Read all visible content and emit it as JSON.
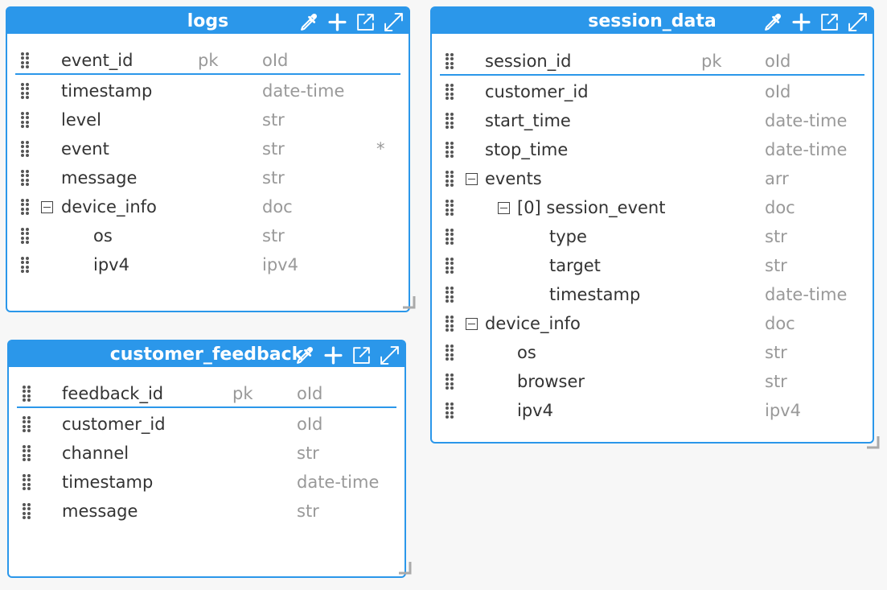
{
  "entities": {
    "logs": {
      "title": "logs",
      "fields": [
        {
          "name": "event_id",
          "key": "pk",
          "type": "oId",
          "req": ""
        },
        {
          "name": "timestamp",
          "key": "",
          "type": "date-time",
          "req": ""
        },
        {
          "name": "level",
          "key": "",
          "type": "str",
          "req": ""
        },
        {
          "name": "event",
          "key": "",
          "type": "str",
          "req": "*"
        },
        {
          "name": "message",
          "key": "",
          "type": "str",
          "req": ""
        },
        {
          "name": "device_info",
          "key": "",
          "type": "doc",
          "req": ""
        },
        {
          "name": "os",
          "key": "",
          "type": "str",
          "req": ""
        },
        {
          "name": "ipv4",
          "key": "",
          "type": "ipv4",
          "req": ""
        }
      ]
    },
    "customer_feedback": {
      "title": "customer_feedback",
      "fields": [
        {
          "name": "feedback_id",
          "key": "pk",
          "type": "oId"
        },
        {
          "name": "customer_id",
          "key": "",
          "type": "oId"
        },
        {
          "name": "channel",
          "key": "",
          "type": "str"
        },
        {
          "name": "timestamp",
          "key": "",
          "type": "date-time"
        },
        {
          "name": "message",
          "key": "",
          "type": "str"
        }
      ]
    },
    "session_data": {
      "title": "session_data",
      "fields": [
        {
          "name": "session_id",
          "key": "pk",
          "type": "oId"
        },
        {
          "name": "customer_id",
          "key": "",
          "type": "oId"
        },
        {
          "name": "start_time",
          "key": "",
          "type": "date-time"
        },
        {
          "name": "stop_time",
          "key": "",
          "type": "date-time"
        },
        {
          "name": "events",
          "key": "",
          "type": "arr"
        },
        {
          "name": "[0] session_event",
          "key": "",
          "type": "doc"
        },
        {
          "name": "type",
          "key": "",
          "type": "str"
        },
        {
          "name": "target",
          "key": "",
          "type": "str"
        },
        {
          "name": "timestamp",
          "key": "",
          "type": "date-time"
        },
        {
          "name": "device_info",
          "key": "",
          "type": "doc"
        },
        {
          "name": "os",
          "key": "",
          "type": "str"
        },
        {
          "name": "browser",
          "key": "",
          "type": "str"
        },
        {
          "name": "ipv4",
          "key": "",
          "type": "ipv4"
        }
      ]
    }
  },
  "icons": [
    "eyedropper-icon",
    "plus-icon",
    "open-external-icon",
    "expand-icon"
  ],
  "colors": {
    "accent": "#2b97ea",
    "type_text": "#999999",
    "name_text": "#333333"
  }
}
